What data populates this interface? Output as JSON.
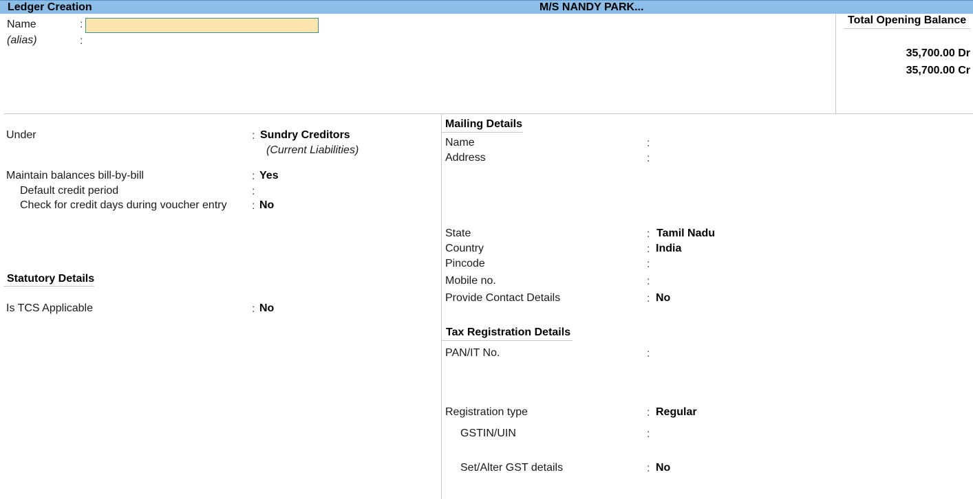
{
  "titlebar": {
    "screen_title": "Ledger Creation",
    "company": "M/S NANDY PARK..."
  },
  "header": {
    "name_label": "Name",
    "name_value": "",
    "alias_label": "(alias)",
    "colon": ":"
  },
  "opening_balance": {
    "title": "Total Opening Balance",
    "debit": "35,700.00 Dr",
    "credit": "35,700.00 Cr"
  },
  "left": {
    "under_label": "Under",
    "under_value": "Sundry Creditors",
    "under_parent": "(Current Liabilities)",
    "bill_by_bill_label": "Maintain balances bill-by-bill",
    "bill_by_bill_value": "Yes",
    "credit_period_label": "Default credit period",
    "credit_period_value": "",
    "check_credit_label": "Check for credit days during voucher entry",
    "check_credit_value": "No",
    "statutory_heading": "Statutory Details",
    "tcs_label": "Is TCS Applicable",
    "tcs_value": "No"
  },
  "mailing": {
    "heading": "Mailing Details",
    "name_label": "Name",
    "name_value": "",
    "address_label": "Address",
    "address_value": "",
    "state_label": "State",
    "state_value": "Tamil Nadu",
    "country_label": "Country",
    "country_value": "India",
    "pincode_label": "Pincode",
    "pincode_value": "",
    "mobile_label": "Mobile no.",
    "mobile_value": "",
    "contact_label": "Provide Contact Details",
    "contact_value": "No"
  },
  "tax": {
    "heading": "Tax Registration Details",
    "pan_label": "PAN/IT No.",
    "pan_value": "",
    "reg_type_label": "Registration type",
    "reg_type_value": "Regular",
    "gstin_label": "GSTIN/UIN",
    "gstin_value": "",
    "gst_details_label": "Set/Alter GST details",
    "gst_details_value": "No"
  },
  "colors": {
    "titlebar": "#8cbde6",
    "input_bg": "#fde6ad",
    "input_border": "#3f8f8f"
  }
}
